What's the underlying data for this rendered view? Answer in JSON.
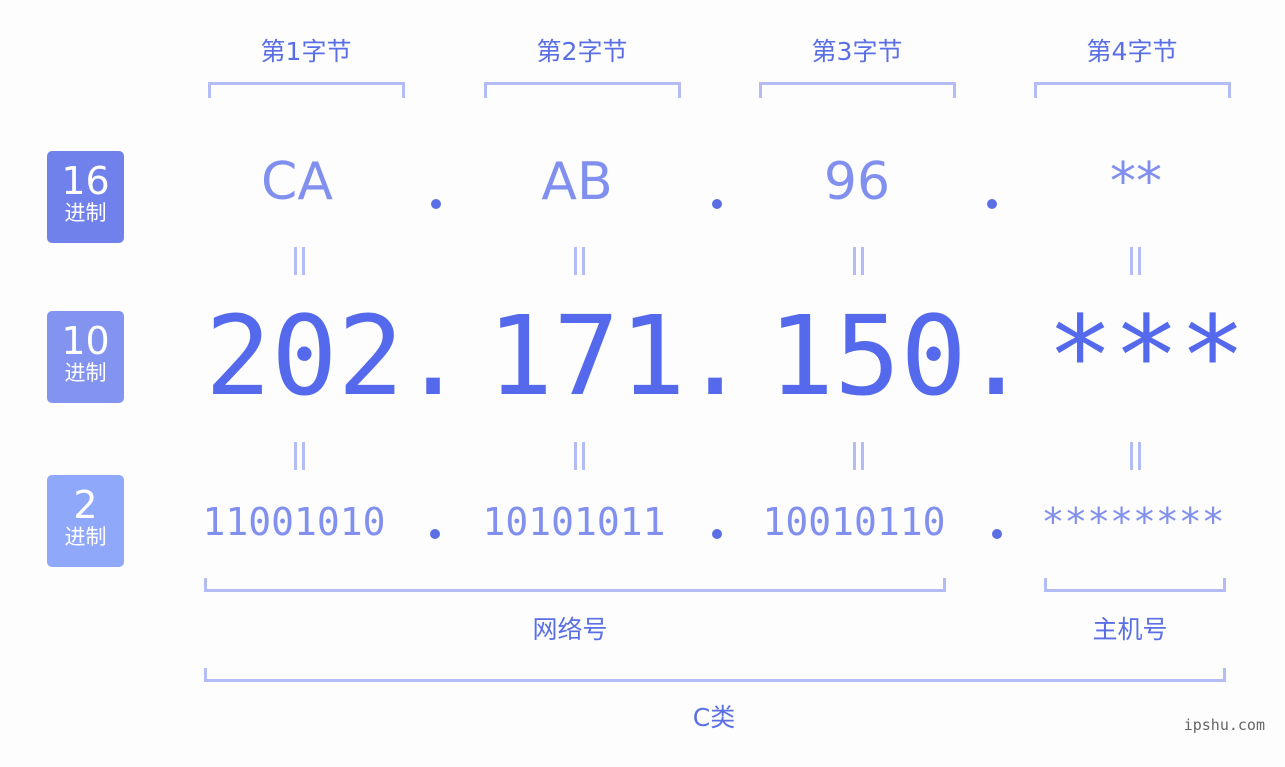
{
  "byte_titles": [
    "第1字节",
    "第2字节",
    "第3字节",
    "第4字节"
  ],
  "badges": [
    {
      "num": "16",
      "label": "进制",
      "color": "#7181eb"
    },
    {
      "num": "10",
      "label": "进制",
      "color": "#8393f0"
    },
    {
      "num": "2",
      "label": "进制",
      "color": "#90a8fa"
    }
  ],
  "hex": [
    "CA",
    "AB",
    "96",
    "**"
  ],
  "decimal": [
    "202",
    "171",
    "150",
    "***"
  ],
  "decimal_separator": ".",
  "binary": [
    "11001010",
    "10101011",
    "10010110",
    "********"
  ],
  "groups": {
    "network": "网络号",
    "host": "主机号",
    "class": "C类"
  },
  "watermark": "ipshu.com",
  "colors": {
    "accent": "#5569ec",
    "light": "#8190ee",
    "bracket": "#b3bcf5"
  }
}
